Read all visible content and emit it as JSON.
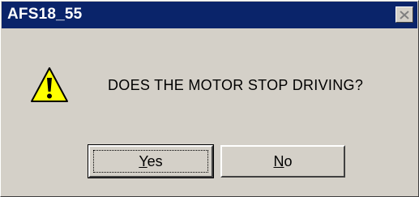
{
  "window": {
    "title": "AFS18_55"
  },
  "dialog": {
    "icon": "warning-icon",
    "message": "DOES THE MOTOR STOP DRIVING?"
  },
  "buttons": {
    "yes": {
      "mnemonic": "Y",
      "rest": "es"
    },
    "no": {
      "mnemonic": "N",
      "rest": "o"
    }
  },
  "colors": {
    "titlebar": "#0a246a",
    "face": "#d4d0c8",
    "warning_yellow": "#ffff00"
  }
}
